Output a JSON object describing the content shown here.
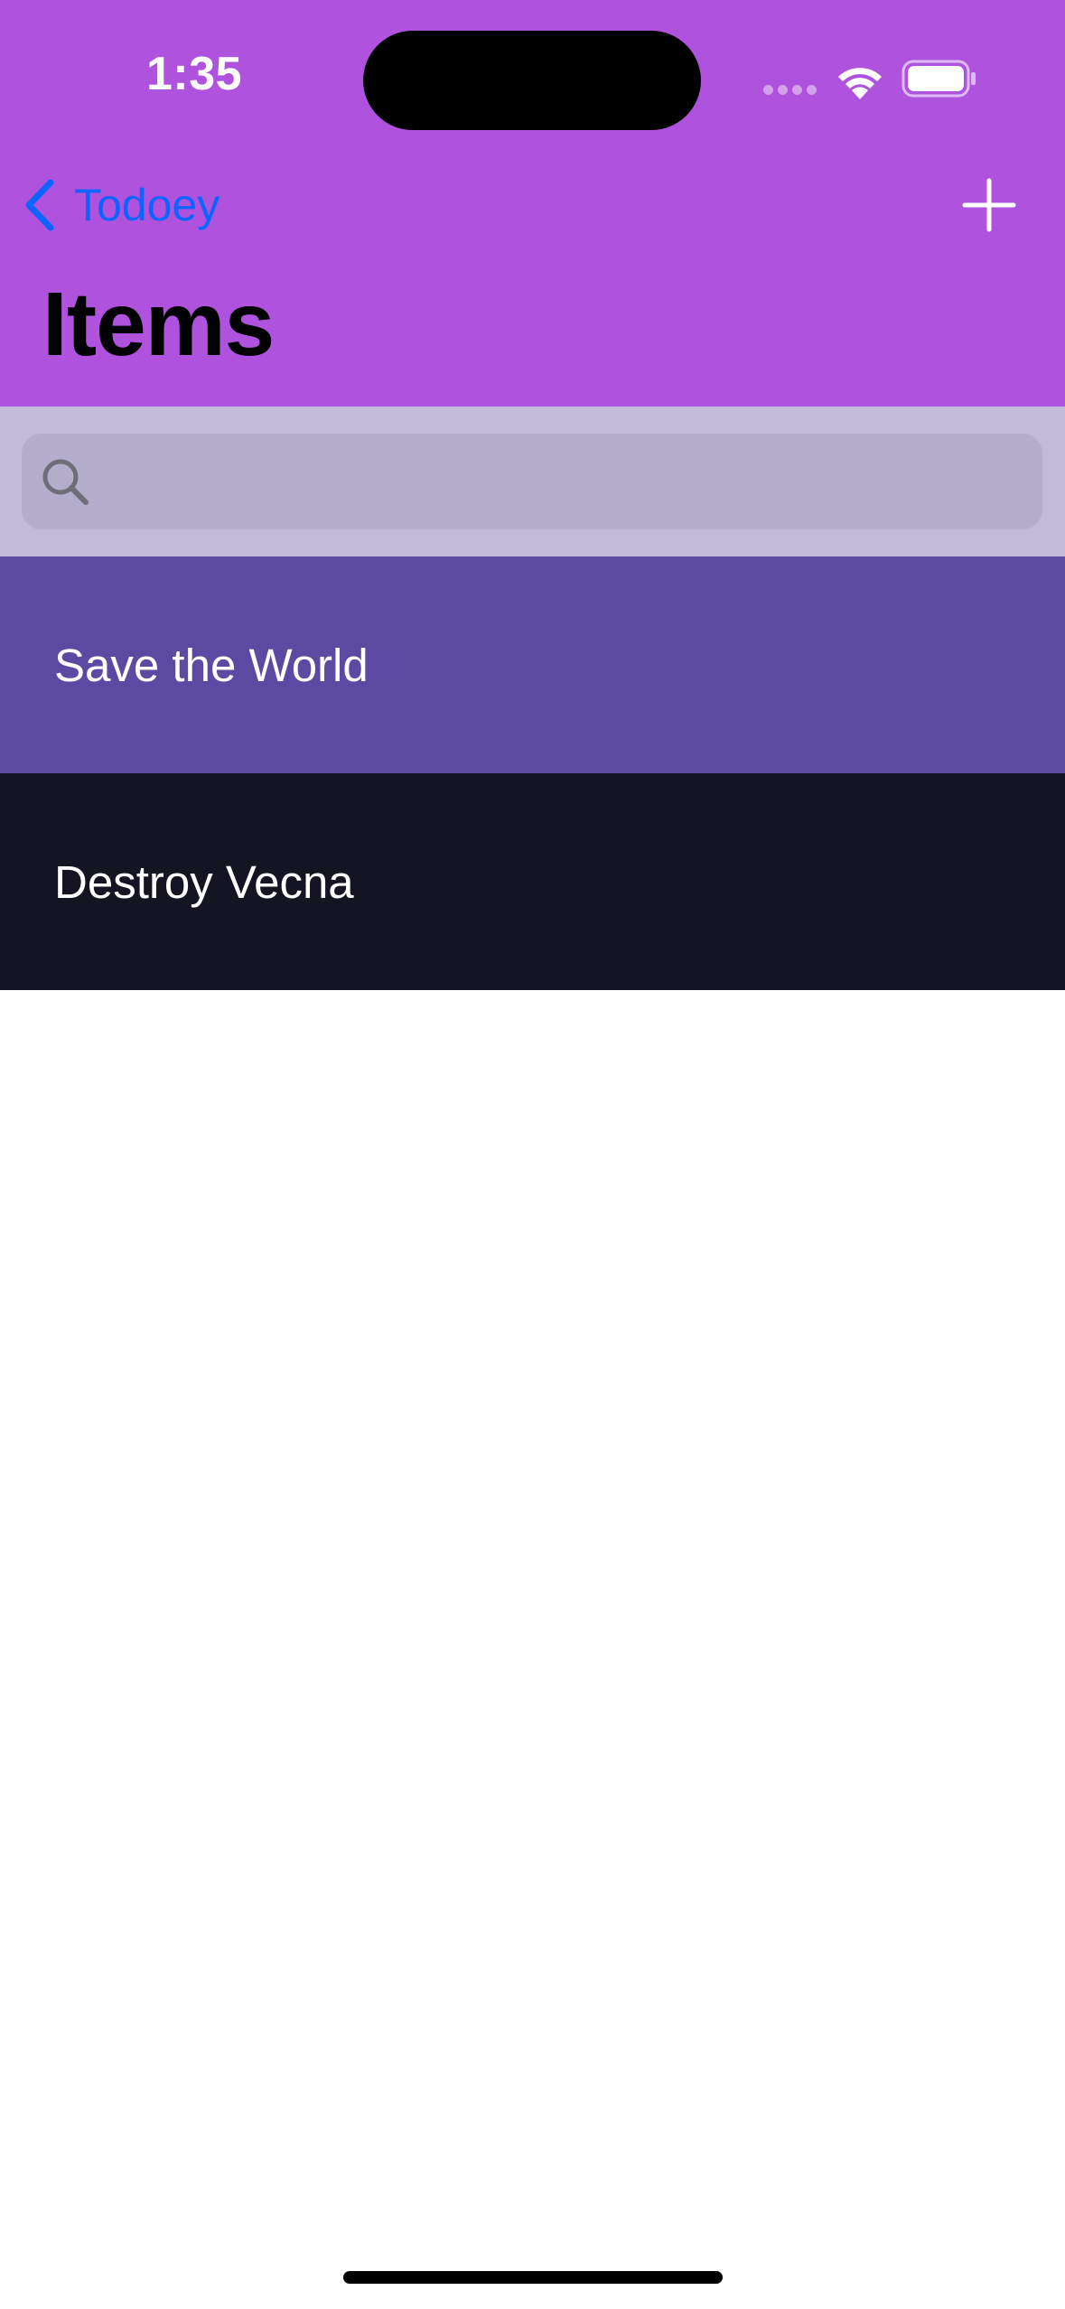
{
  "status_bar": {
    "time": "1:35"
  },
  "nav": {
    "back_label": "Todoey",
    "back_icon": "chevron-left-icon",
    "add_icon": "plus-icon",
    "title": "Items"
  },
  "search": {
    "placeholder": "",
    "value": "",
    "icon": "magnifying-glass-icon"
  },
  "items": [
    {
      "label": "Save the World",
      "color": "#5c4aa2"
    },
    {
      "label": "Destroy Vecna",
      "color": "#151423"
    }
  ],
  "colors": {
    "nav_background": "#af52de",
    "search_background": "#c1bad8",
    "search_field": "#b5adcc",
    "tint": "#0a64ff",
    "page_background": "#ffffff"
  }
}
